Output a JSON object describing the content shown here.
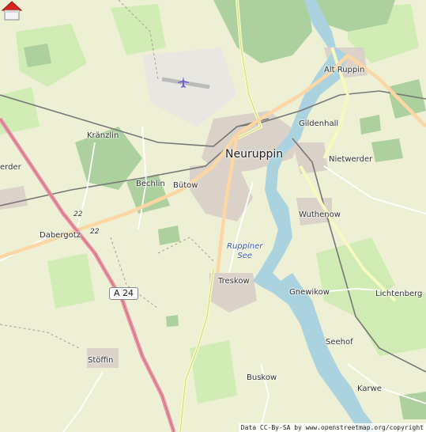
{
  "map": {
    "places": [
      {
        "name": "Neuruppin",
        "type": "town"
      },
      {
        "name": "Alt Ruppin",
        "type": "village"
      },
      {
        "name": "Gildenhall",
        "type": "village"
      },
      {
        "name": "Nietwerder",
        "type": "village"
      },
      {
        "name": "Kränzlin",
        "type": "village"
      },
      {
        "name": "Bechlin",
        "type": "village"
      },
      {
        "name": "Bütow",
        "type": "village"
      },
      {
        "name": "Wuthenow",
        "type": "village"
      },
      {
        "name": "Dabergotz",
        "type": "village"
      },
      {
        "name": "Treskow",
        "type": "village"
      },
      {
        "name": "Gnewikow",
        "type": "village"
      },
      {
        "name": "Lichtenberg",
        "type": "village"
      },
      {
        "name": "Seehof",
        "type": "village"
      },
      {
        "name": "Stöffin",
        "type": "village"
      },
      {
        "name": "Buskow",
        "type": "village"
      },
      {
        "name": "Karwe",
        "type": "village"
      },
      {
        "name": "erder",
        "type": "village"
      }
    ],
    "water": {
      "lake_name_line1": "Ruppiner",
      "lake_name_line2": "See"
    },
    "roads": {
      "motorway_ref": "A 24",
      "federal_ref_1": "22",
      "federal_ref_2": "22"
    },
    "marker": {
      "icon": "house-icon"
    },
    "attribution": {
      "prefix": "Data CC-By-SA by ",
      "source": "www.openstreetmap.org/copyright"
    },
    "colors": {
      "land": "#eef0d5",
      "forest": "#add19e",
      "meadow": "#cdebb0",
      "water": "#aad3df",
      "urban": "#d9d0c9",
      "motorway": "#e892a2",
      "primary": "#fcd6a4",
      "secondary": "#f7fabf",
      "rail": "#777777"
    }
  }
}
